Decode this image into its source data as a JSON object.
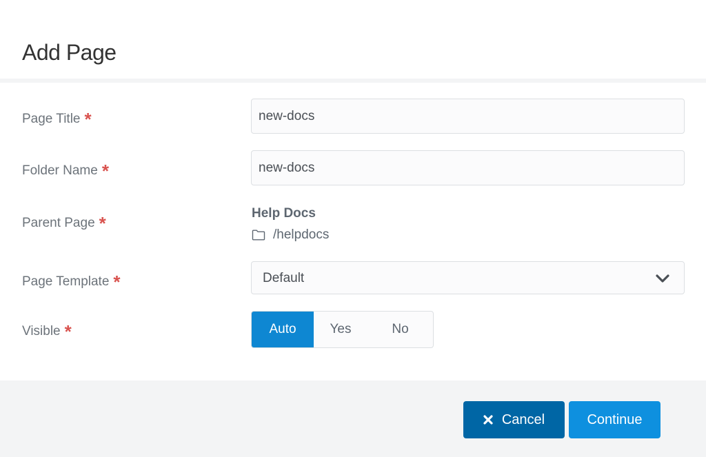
{
  "modal": {
    "title": "Add Page"
  },
  "form": {
    "page_title": {
      "label": "Page Title",
      "required_mark": "*",
      "value": "new-docs"
    },
    "folder_name": {
      "label": "Folder Name",
      "required_mark": "*",
      "value": "new-docs"
    },
    "parent_page": {
      "label": "Parent Page",
      "required_mark": "*",
      "name": "Help Docs",
      "path": "/helpdocs",
      "icon": "folder-icon"
    },
    "page_template": {
      "label": "Page Template",
      "required_mark": "*",
      "selected": "Default",
      "icon": "chevron-down-icon"
    },
    "visible": {
      "label": "Visible",
      "required_mark": "*",
      "options": [
        "Auto",
        "Yes",
        "No"
      ],
      "selected": "Auto"
    }
  },
  "footer": {
    "cancel_label": "Cancel",
    "cancel_icon": "close-icon",
    "continue_label": "Continue"
  },
  "colors": {
    "accent": "#0e90df",
    "accent_dark": "#0066a5",
    "required": "#d9534f"
  }
}
